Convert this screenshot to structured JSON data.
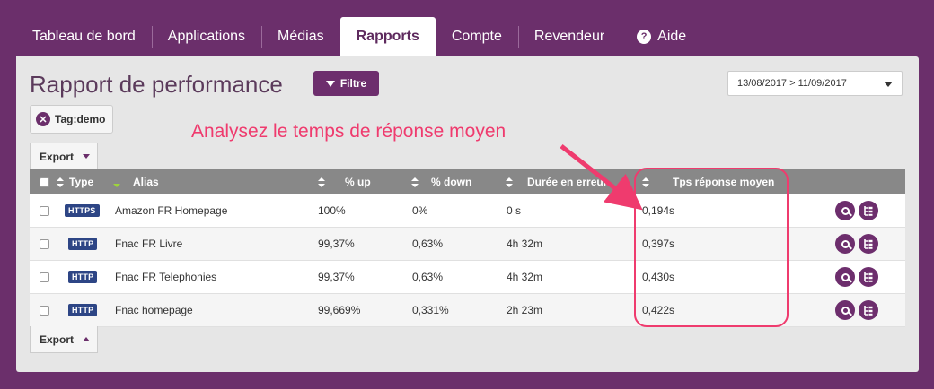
{
  "nav": {
    "items": [
      {
        "label": "Tableau de bord",
        "active": false
      },
      {
        "label": "Applications",
        "active": false
      },
      {
        "label": "Médias",
        "active": false
      },
      {
        "label": "Rapports",
        "active": true
      },
      {
        "label": "Compte",
        "active": false
      },
      {
        "label": "Revendeur",
        "active": false
      },
      {
        "label": "Aide",
        "active": false,
        "icon": "help-icon"
      }
    ]
  },
  "page": {
    "title": "Rapport de performance",
    "filter_label": "Filtre",
    "date_range": "13/08/2017 > 11/09/2017",
    "tag": "Tag:demo",
    "export_label": "Export",
    "annotation": "Analysez le temps de réponse moyen"
  },
  "colors": {
    "brand": "#6b2f6b",
    "annotation": "#ef3b6e",
    "badge": "#2d4585",
    "header": "#888888"
  },
  "table": {
    "headers": [
      "Type",
      "Alias",
      "% up",
      "% down",
      "Durée en erreur",
      "Tps réponse moyen"
    ],
    "rows": [
      {
        "type": "HTTPS",
        "alias": "Amazon FR Homepage",
        "up": "100%",
        "down": "0%",
        "duration": "0 s",
        "response": "0,194s"
      },
      {
        "type": "HTTP",
        "alias": "Fnac FR Livre",
        "up": "99,37%",
        "down": "0,63%",
        "duration": "4h 32m",
        "response": "0,397s"
      },
      {
        "type": "HTTP",
        "alias": "Fnac FR Telephonies",
        "up": "99,37%",
        "down": "0,63%",
        "duration": "4h 32m",
        "response": "0,430s"
      },
      {
        "type": "HTTP",
        "alias": "Fnac homepage",
        "up": "99,669%",
        "down": "0,331%",
        "duration": "2h 23m",
        "response": "0,422s"
      }
    ]
  }
}
